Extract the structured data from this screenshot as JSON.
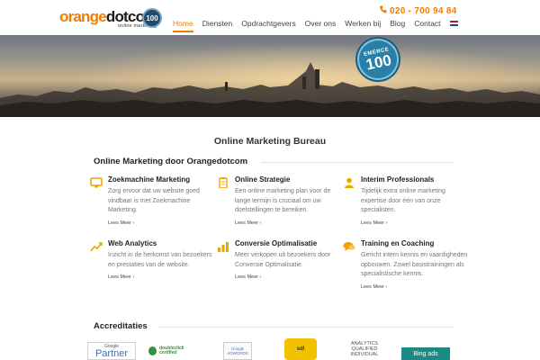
{
  "brand": {
    "logo_part1": "orange",
    "logo_part2": "dotcom",
    "logo_sub": "online marketing",
    "badge": "100",
    "accent_color": "#f07d00"
  },
  "header": {
    "phone_icon": "phone-icon",
    "phone": "020 - 700 94 84"
  },
  "nav": {
    "items": [
      {
        "label": "Home",
        "active": true
      },
      {
        "label": "Diensten"
      },
      {
        "label": "Opdrachtgevers"
      },
      {
        "label": "Over ons"
      },
      {
        "label": "Werken bij"
      },
      {
        "label": "Blog"
      },
      {
        "label": "Contact"
      }
    ],
    "flag_icon": "netherlands-flag-icon"
  },
  "hero": {
    "badge_top": "EMERCE",
    "badge_number": "100"
  },
  "main": {
    "title": "Online Marketing Bureau",
    "section_title": "Online Marketing door Orangedotcom",
    "services": [
      {
        "icon": "monitor-icon",
        "title": "Zoekmachine Marketing",
        "text": "Zorg ervoor dat uw website goed vindbaar is met Zoekmachine Marketing.",
        "more": "Lees Meer ›"
      },
      {
        "icon": "clipboard-icon",
        "title": "Online Strategie",
        "text": "Een online marketing plan voor de lange termijn is cruciaal om uw doelstellingen te bereiken.",
        "more": "Lees Meer ›"
      },
      {
        "icon": "person-icon",
        "title": "Interim Professionals",
        "text": "Tijdelijk extra online marketing expertise door één van onze specialisten.",
        "more": "Lees Meer ›"
      },
      {
        "icon": "trend-up-icon",
        "title": "Web Analytics",
        "text": "Inzicht in de herkomst van bezoekers en prestaties van de website.",
        "more": "Lees Meer ›"
      },
      {
        "icon": "bar-chart-icon",
        "title": "Conversie Optimalisatie",
        "text": "Meer verkopen uit bezoekers door Conversie Optimalisatie.",
        "more": "Lees Meer ›"
      },
      {
        "icon": "chat-icon",
        "title": "Training en Coaching",
        "text": "Gericht intern kennis en vaardigheden opbouwen. Zowel basistrainingen als specialistische kennis.",
        "more": "Lees Meer ›"
      }
    ]
  },
  "accreditations": {
    "title": "Accreditaties",
    "google_top": "Google",
    "google_main": "Partner",
    "double": "doubleclick certified",
    "adwords_top": "Google",
    "adwords_main": "ADWORDS",
    "sdl": "sdl",
    "analytics_1": "ANALYTICS",
    "analytics_2": "QUALIFIED",
    "analytics_3": "INDIVIDUAL",
    "bing": "Bing ads"
  }
}
